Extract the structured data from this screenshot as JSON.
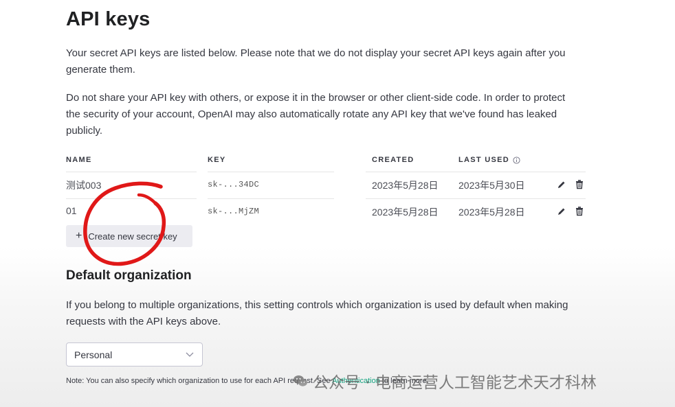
{
  "page": {
    "title": "API keys",
    "intro_1": "Your secret API keys are listed below. Please note that we do not display your secret API keys again after you generate them.",
    "intro_2": "Do not share your API key with others, or expose it in the browser or other client-side code. In order to protect the security of your account, OpenAI may also automatically rotate any API key that we've found has leaked publicly."
  },
  "table": {
    "headers": {
      "name": "NAME",
      "key": "KEY",
      "created": "CREATED",
      "last_used": "LAST USED"
    },
    "rows": [
      {
        "name": "测试003",
        "key": "sk-...34DC",
        "created": "2023年5月28日",
        "last_used": "2023年5月30日"
      },
      {
        "name": "01",
        "key": "sk-...MjZM",
        "created": "2023年5月28日",
        "last_used": "2023年5月28日"
      }
    ]
  },
  "create_button": {
    "icon": "+",
    "label": "Create new secret key"
  },
  "default_org": {
    "title": "Default organization",
    "description": "If you belong to multiple organizations, this setting controls which organization is used by default when making requests with the API keys above.",
    "selected": "Personal",
    "note_prefix": "Note: You can also specify which organization to use for each API request. See ",
    "note_link": "Authentication",
    "note_suffix": " to learn more."
  },
  "watermark": {
    "text": "公众号 · 电商运营人工智能艺术天才科林"
  },
  "colors": {
    "accent": "#10a37f",
    "annotation": "#e01818",
    "button_bg": "#ececf1"
  },
  "icons": [
    "info-icon",
    "pencil-icon",
    "trash-icon",
    "chevron-down-icon",
    "plus-icon",
    "wechat-icon"
  ]
}
